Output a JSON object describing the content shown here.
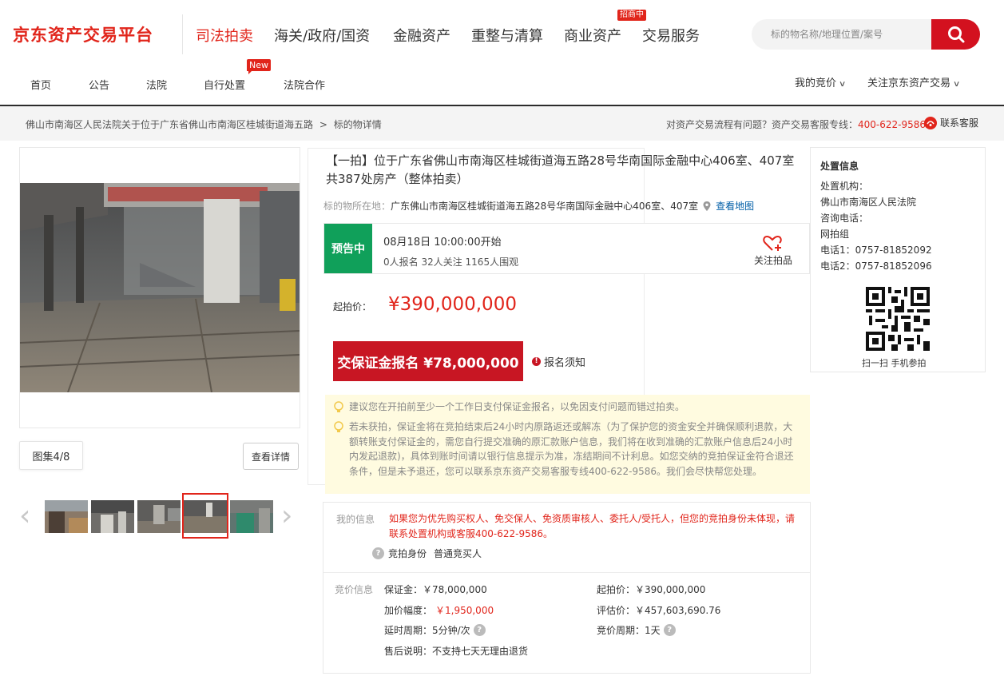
{
  "header": {
    "logo": "京东资产交易平台",
    "top_nav": [
      "司法拍卖",
      "海关/政府/国资",
      "金融资产",
      "重整与清算",
      "商业资产",
      "交易服务"
    ],
    "recruit_badge": "招商中",
    "search_placeholder": "标的物名称/地理位置/案号",
    "sub_nav": [
      "首页",
      "公告",
      "法院",
      "自行处置",
      "法院合作"
    ],
    "new_badge": "New",
    "my_bids": "我的竞价",
    "follow_jd": "关注京东资产交易"
  },
  "breadcrumb": {
    "path": "佛山市南海区人民法院关于位于广东省佛山市南海区桂城街道海五路",
    "separator": ">",
    "current": "标的物详情",
    "help_text": "对资产交易流程有问题？资产交易客服专线：",
    "help_phone": "400-622-9586",
    "cs_link": "联系客服"
  },
  "gallery": {
    "album_label": "图集4/8",
    "view_detail": "查看详情",
    "selected_thumb_index": 4,
    "thumb_count_visible": 5
  },
  "item": {
    "title": "【一拍】位于广东省佛山市南海区桂城街道海五路28号华南国际金融中心406室、407室共387处房产（整体拍卖）",
    "location_label": "标的物所在地：",
    "location": "广东佛山市南海区桂城街道海五路28号华南国际金融中心406室、407室",
    "map_link": "查看地图",
    "status": "预告中",
    "start_time": "08月18日 10:00:00开始",
    "stats": "0人报名  32人关注  1165人围观",
    "follow_label": "关注拍品",
    "start_price_label": "起拍价：",
    "start_price": "¥390,000,000",
    "deposit_button": "交保证金报名  ¥78,000,000",
    "notice_link": "报名须知"
  },
  "tips": [
    "建议您在开拍前至少一个工作日支付保证金报名，以免因支付问题而错过拍卖。",
    "若未获拍，保证金将在竞拍结束后24小时内原路返还或解冻（为了保护您的资金安全并确保顺利退款，大额转账支付保证金的，需您自行提交准确的原汇款账户信息，我们将在收到准确的汇款账户信息后24小时内发起退款)，具体到账时间请以银行信息提示为准，冻结期间不计利息。如您交纳的竞拍保证金符合退还条件，但是未予退还，您可以联系京东资产交易客服专线400-622-9586。我们会尽快帮您处理。"
  ],
  "my_info": {
    "label": "我的信息",
    "warning": "如果您为优先购买权人、免交保人、免资质审核人、委托人/受托人，但您的竞拍身份未体现，请联系处置机构或客服400-622-9586。",
    "identity_label": "竞拍身份",
    "identity_value": "普通竞买人"
  },
  "bid_info": {
    "label": "竞价信息",
    "deposit": "保证金：￥78,000,000",
    "increment_label": "加价幅度：",
    "increment_value": "￥1,950,000",
    "extension": "延时周期：5分钟/次",
    "after_sale": "售后说明：不支持七天无理由退货",
    "start_price": "起拍价：￥390,000,000",
    "appraisal": "评估价：￥457,603,690.76",
    "bid_period": "竞价周期：1天"
  },
  "disposal": {
    "title": "处置信息",
    "org_label": "处置机构：",
    "org": "佛山市南海区人民法院",
    "phone_label": "咨询电话：",
    "group": "网拍组",
    "phone1": "电话1：0757-81852092",
    "phone2": "电话2：0757-81852096",
    "qr_caption": "扫一扫 手机参拍"
  },
  "colors": {
    "brand_red": "#e1251b",
    "status_green": "#10a05a",
    "button_red": "#c81623",
    "tip_bg": "#fffbe0"
  }
}
